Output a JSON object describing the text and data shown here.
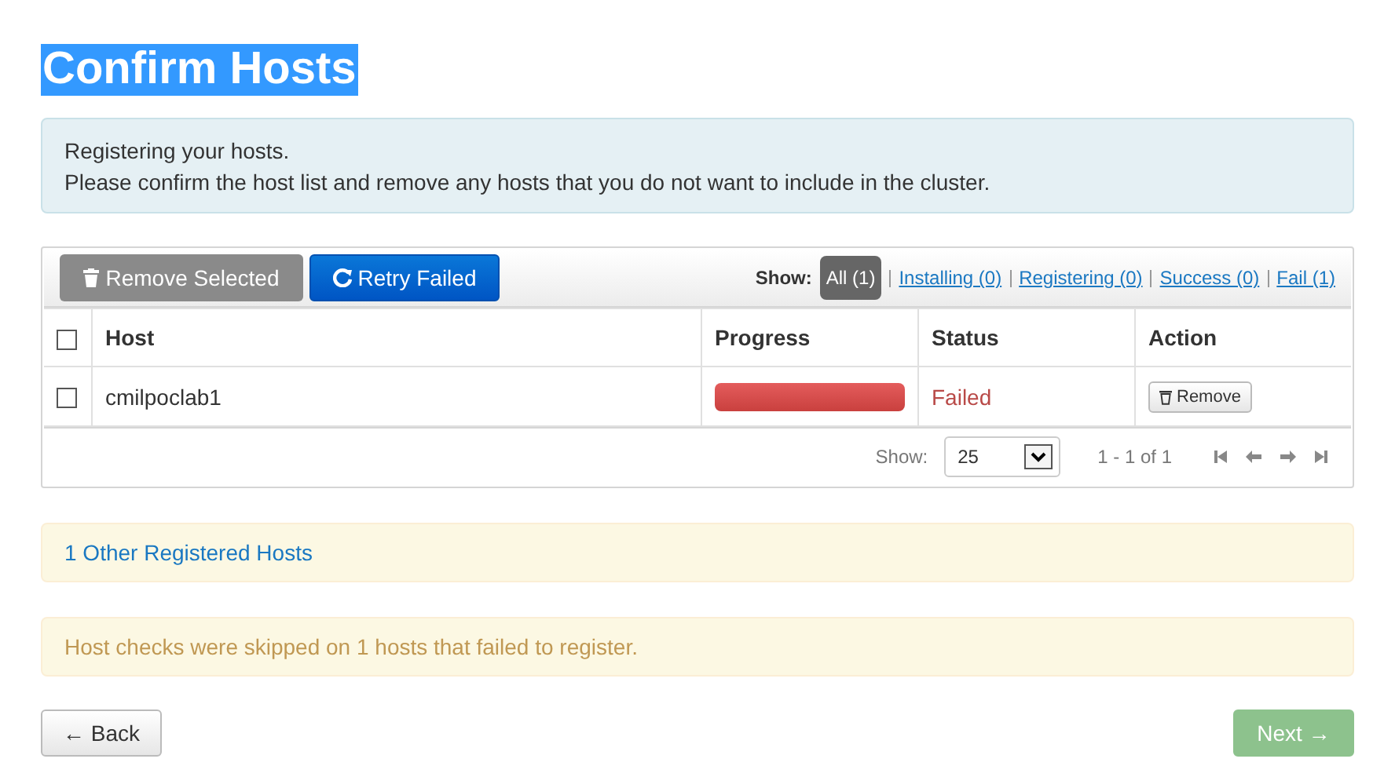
{
  "title": "Confirm Hosts",
  "info": [
    "Registering your hosts.",
    "Please confirm the host list and remove any hosts that you do not want to include in the cluster."
  ],
  "toolbar": {
    "buttons": [
      {
        "kind": "remove",
        "label": "Remove Selected"
      },
      {
        "kind": "retry",
        "label": "Retry Failed"
      }
    ],
    "filter_label": "Show:",
    "filters": [
      {
        "label": "All (1)",
        "selected": true
      },
      {
        "label": "Installing (0)",
        "selected": false
      },
      {
        "label": "Registering (0)",
        "selected": false
      },
      {
        "label": "Success (0)",
        "selected": false
      },
      {
        "label": "Fail (1)",
        "selected": false
      }
    ]
  },
  "table": {
    "select_all_checked": false,
    "columns": [
      "Host",
      "Progress",
      "Status",
      "Action"
    ],
    "rows": [
      {
        "checked": false,
        "host": "cmilpoclab1",
        "level": 1,
        "status": "Failed",
        "failed": true,
        "action": "Remove"
      }
    ]
  },
  "pager": {
    "label": "Show:",
    "page_size": "25",
    "range": "1 - 1 of 1"
  },
  "alerts": [
    {
      "kind": "link",
      "text": "1 Other Registered Hosts"
    },
    {
      "kind": "warning",
      "text": "Host checks were skipped on 1 hosts that failed to register."
    }
  ],
  "back": {
    "label": "← Back",
    "disabled": false
  },
  "next": {
    "label": "Next →",
    "disabled": true
  }
}
